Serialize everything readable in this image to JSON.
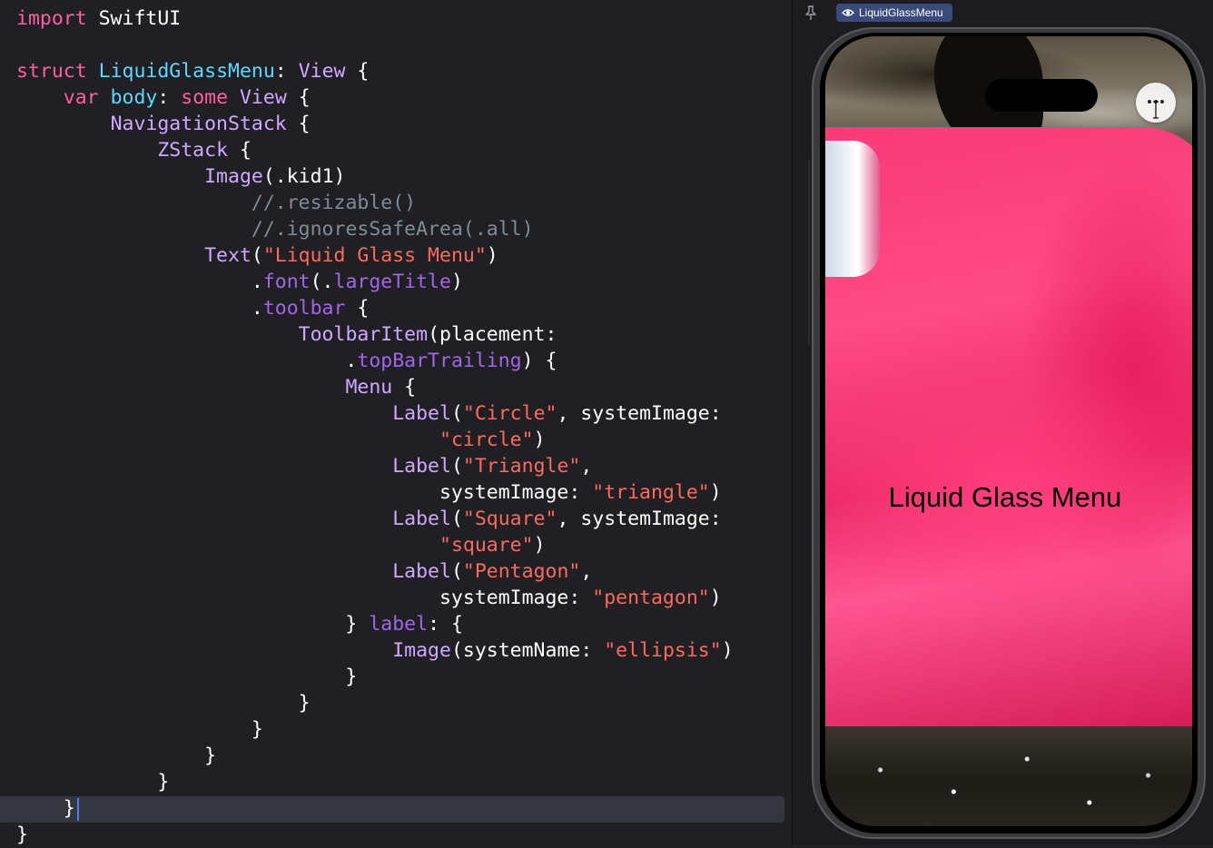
{
  "editor": {
    "lines": [
      [
        {
          "t": "import",
          "c": "kw"
        },
        {
          "t": " SwiftUI",
          "c": "plain"
        }
      ],
      [],
      [
        {
          "t": "struct",
          "c": "kw"
        },
        {
          "t": " ",
          "c": "plain"
        },
        {
          "t": "LiquidGlassMenu",
          "c": "type"
        },
        {
          "t": ": ",
          "c": "plain"
        },
        {
          "t": "View",
          "c": "ftype"
        },
        {
          "t": " {",
          "c": "plain"
        }
      ],
      [
        {
          "t": "    ",
          "c": "plain"
        },
        {
          "t": "var",
          "c": "kw"
        },
        {
          "t": " ",
          "c": "plain"
        },
        {
          "t": "body",
          "c": "type"
        },
        {
          "t": ": ",
          "c": "plain"
        },
        {
          "t": "some",
          "c": "kw"
        },
        {
          "t": " ",
          "c": "plain"
        },
        {
          "t": "View",
          "c": "ftype"
        },
        {
          "t": " {",
          "c": "plain"
        }
      ],
      [
        {
          "t": "        ",
          "c": "plain"
        },
        {
          "t": "NavigationStack",
          "c": "ftype"
        },
        {
          "t": " {",
          "c": "plain"
        }
      ],
      [
        {
          "t": "            ",
          "c": "plain"
        },
        {
          "t": "ZStack",
          "c": "ftype"
        },
        {
          "t": " {",
          "c": "plain"
        }
      ],
      [
        {
          "t": "                ",
          "c": "plain"
        },
        {
          "t": "Image",
          "c": "ftype"
        },
        {
          "t": "(.kid1)",
          "c": "plain"
        }
      ],
      [
        {
          "t": "                    ",
          "c": "plain"
        },
        {
          "t": "//.resizable()",
          "c": "comment"
        }
      ],
      [
        {
          "t": "                    ",
          "c": "plain"
        },
        {
          "t": "//.ignoresSafeArea(.all)",
          "c": "comment"
        }
      ],
      [
        {
          "t": "                ",
          "c": "plain"
        },
        {
          "t": "Text",
          "c": "ftype"
        },
        {
          "t": "(",
          "c": "plain"
        },
        {
          "t": "\"Liquid Glass Menu\"",
          "c": "str"
        },
        {
          "t": ")",
          "c": "plain"
        }
      ],
      [
        {
          "t": "                    .",
          "c": "plain"
        },
        {
          "t": "font",
          "c": "member"
        },
        {
          "t": "(.",
          "c": "plain"
        },
        {
          "t": "largeTitle",
          "c": "member"
        },
        {
          "t": ")",
          "c": "plain"
        }
      ],
      [
        {
          "t": "                    .",
          "c": "plain"
        },
        {
          "t": "toolbar",
          "c": "member"
        },
        {
          "t": " {",
          "c": "plain"
        }
      ],
      [
        {
          "t": "                        ",
          "c": "plain"
        },
        {
          "t": "ToolbarItem",
          "c": "ftype"
        },
        {
          "t": "(placement:",
          "c": "plain"
        }
      ],
      [
        {
          "t": "                            .",
          "c": "plain"
        },
        {
          "t": "topBarTrailing",
          "c": "member"
        },
        {
          "t": ") {",
          "c": "plain"
        }
      ],
      [
        {
          "t": "                            ",
          "c": "plain"
        },
        {
          "t": "Menu",
          "c": "ftype"
        },
        {
          "t": " {",
          "c": "plain"
        }
      ],
      [
        {
          "t": "                                ",
          "c": "plain"
        },
        {
          "t": "Label",
          "c": "ftype"
        },
        {
          "t": "(",
          "c": "plain"
        },
        {
          "t": "\"Circle\"",
          "c": "str"
        },
        {
          "t": ", systemImage:",
          "c": "plain"
        }
      ],
      [
        {
          "t": "                                    ",
          "c": "plain"
        },
        {
          "t": "\"circle\"",
          "c": "str"
        },
        {
          "t": ")",
          "c": "plain"
        }
      ],
      [
        {
          "t": "                                ",
          "c": "plain"
        },
        {
          "t": "Label",
          "c": "ftype"
        },
        {
          "t": "(",
          "c": "plain"
        },
        {
          "t": "\"Triangle\"",
          "c": "str"
        },
        {
          "t": ",",
          "c": "plain"
        }
      ],
      [
        {
          "t": "                                    systemImage: ",
          "c": "plain"
        },
        {
          "t": "\"triangle\"",
          "c": "str"
        },
        {
          "t": ")",
          "c": "plain"
        }
      ],
      [
        {
          "t": "                                ",
          "c": "plain"
        },
        {
          "t": "Label",
          "c": "ftype"
        },
        {
          "t": "(",
          "c": "plain"
        },
        {
          "t": "\"Square\"",
          "c": "str"
        },
        {
          "t": ", systemImage:",
          "c": "plain"
        }
      ],
      [
        {
          "t": "                                    ",
          "c": "plain"
        },
        {
          "t": "\"square\"",
          "c": "str"
        },
        {
          "t": ")",
          "c": "plain"
        }
      ],
      [
        {
          "t": "                                ",
          "c": "plain"
        },
        {
          "t": "Label",
          "c": "ftype"
        },
        {
          "t": "(",
          "c": "plain"
        },
        {
          "t": "\"Pentagon\"",
          "c": "str"
        },
        {
          "t": ",",
          "c": "plain"
        }
      ],
      [
        {
          "t": "                                    systemImage: ",
          "c": "plain"
        },
        {
          "t": "\"pentagon\"",
          "c": "str"
        },
        {
          "t": ")",
          "c": "plain"
        }
      ],
      [
        {
          "t": "                            } ",
          "c": "plain"
        },
        {
          "t": "label",
          "c": "member"
        },
        {
          "t": ": {",
          "c": "plain"
        }
      ],
      [
        {
          "t": "                                ",
          "c": "plain"
        },
        {
          "t": "Image",
          "c": "ftype"
        },
        {
          "t": "(systemName: ",
          "c": "plain"
        },
        {
          "t": "\"ellipsis\"",
          "c": "str"
        },
        {
          "t": ")",
          "c": "plain"
        }
      ],
      [
        {
          "t": "                            }",
          "c": "plain"
        }
      ],
      [
        {
          "t": "                        }",
          "c": "plain"
        }
      ],
      [
        {
          "t": "                    }",
          "c": "plain"
        }
      ],
      [
        {
          "t": "                }",
          "c": "plain"
        }
      ],
      [
        {
          "t": "            }",
          "c": "plain"
        }
      ],
      [
        {
          "t": "    }",
          "c": "plain"
        }
      ],
      [
        {
          "t": "}",
          "c": "plain"
        }
      ]
    ]
  },
  "canvas": {
    "preview_label": "LiquidGlassMenu",
    "pin_icon": "pin-icon",
    "eye_icon": "eye-icon"
  },
  "preview": {
    "title": "Liquid Glass Menu",
    "menu_icon": "ellipsis-icon",
    "background": "photo of pink garment in water"
  },
  "colors": {
    "keyword": "#fc5fa3",
    "type": "#5dd8ff",
    "framework_type": "#d0a8ff",
    "member": "#a167e6",
    "string": "#fc6a5d",
    "comment": "#7f8c98",
    "editor_bg": "#1f1f24",
    "chip_bg": "#3a4a7a"
  }
}
